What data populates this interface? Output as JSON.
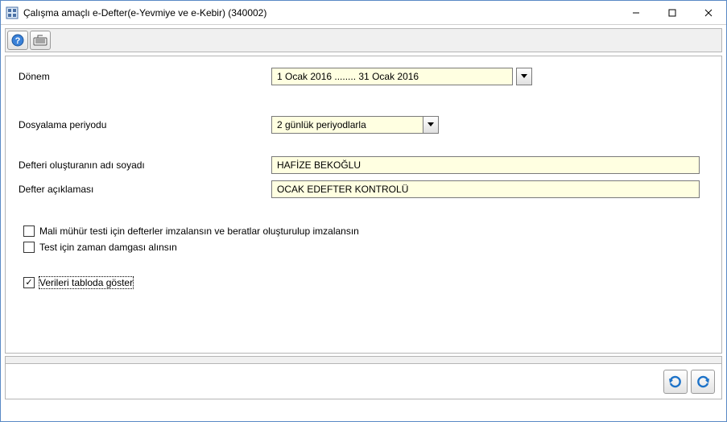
{
  "window": {
    "title": "Çalışma amaçlı e-Defter(e-Yevmiye ve e-Kebir) (340002)"
  },
  "form": {
    "period_label": "Dönem",
    "period_value": "1 Ocak 2016 ........ 31 Ocak 2016",
    "filing_label": "Dosyalama periyodu",
    "filing_value": "2 günlük periyodlarla",
    "creator_label": "Defteri oluşturanın adı soyadı",
    "creator_value": "HAFİZE BEKOĞLU",
    "desc_label": "Defter açıklaması",
    "desc_value": "OCAK EDEFTER KONTROLÜ",
    "cb1_label": "Mali mühür testi için defterler imzalansın ve beratlar oluşturulup imzalansın",
    "cb1_checked": false,
    "cb2_label": "Test için zaman damgası alınsın",
    "cb2_checked": false,
    "cb3_label": "Verileri tabloda göster",
    "cb3_checked": true
  }
}
